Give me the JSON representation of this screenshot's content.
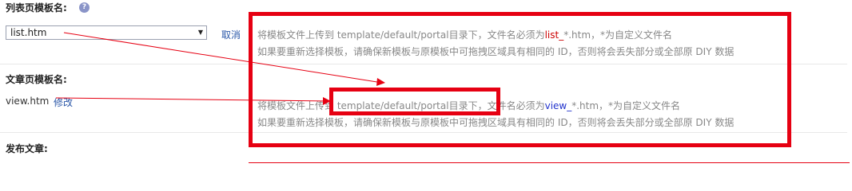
{
  "list_template": {
    "label": "列表页模板名:",
    "help_icon": "?",
    "selected": "list.htm",
    "cancel_label": "取消",
    "hint_line1_pre": "将模板文件上传到  template/default/portal目录下，文件名必须为",
    "hint_line1_kw": "list_",
    "hint_line1_post": "*.htm，*为自定义文件名",
    "hint_line2": "如果要重新选择模板，请确保新模板与原模板中可拖拽区域具有相同的  ID，否则将会丢失部分或全部原  DIY 数据"
  },
  "article_template": {
    "label": "文章页模板名:",
    "current": "view.htm",
    "edit_label": "修改",
    "hint_line1_pre": "将模板文件上传到  template/default/portal目录下，文件名必须为",
    "hint_line1_kw": "view_",
    "hint_line1_post": "*.htm，*为自定义文件名",
    "hint_line2": "如果要重新选择模板，请确保新模板与原模板中可拖拽区域具有相同的  ID，否则将会丢失部分或全部原  DIY 数据"
  },
  "publish": {
    "label": "发布文章:"
  },
  "colors": {
    "annotation_red": "#e60012",
    "link_blue": "#2a57a8",
    "keyword_red": "#cc0000",
    "keyword_blue": "#2233cc"
  }
}
